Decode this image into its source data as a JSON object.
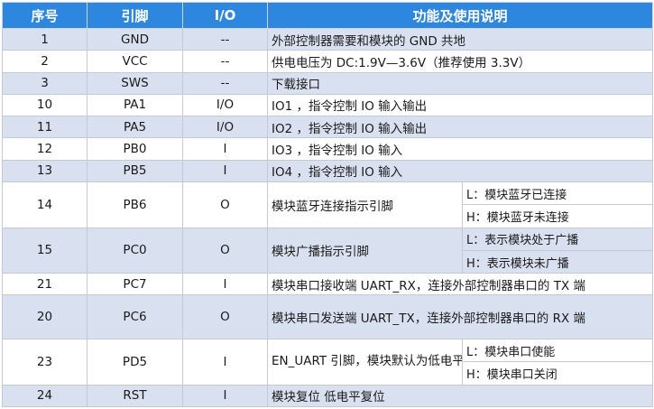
{
  "headers": {
    "index": "序号",
    "pin": "引脚",
    "io": "I/O",
    "function": "功能及使用说明"
  },
  "rows": [
    {
      "index": "1",
      "pin": "GND",
      "io": "--",
      "desc": "外部控制器需要和模块的 GND 共地"
    },
    {
      "index": "2",
      "pin": "VCC",
      "io": "--",
      "desc": "供电电压为 DC:1.9V—3.6V（推荐使用 3.3V）"
    },
    {
      "index": "3",
      "pin": "SWS",
      "io": "--",
      "desc": "下载接口"
    },
    {
      "index": "10",
      "pin": "PA1",
      "io": "I/O",
      "desc": "IO1 ，指令控制  IO 输入输出"
    },
    {
      "index": "11",
      "pin": "PA5",
      "io": "I/O",
      "desc": "IO2 ，指令控制  IO 输入输出"
    },
    {
      "index": "12",
      "pin": "PB0",
      "io": "I",
      "desc": "IO3 ，指令控制  IO 输入"
    },
    {
      "index": "13",
      "pin": "PB5",
      "io": "I",
      "desc": "IO4 ，指令控制  IO 输入"
    },
    {
      "index": "14",
      "pin": "PB6",
      "io": "O",
      "desc": "模块蓝牙连接指示引脚",
      "notes": [
        "L：模块蓝牙已连接",
        "H：模块蓝牙未连接"
      ]
    },
    {
      "index": "15",
      "pin": "PC0",
      "io": "O",
      "desc": "模块广播指示引脚",
      "notes": [
        "L：表示模块处于广播",
        "H：表示模块未广播"
      ]
    },
    {
      "index": "21",
      "pin": "PC7",
      "io": "I",
      "desc": "模块串口接收端  UART_RX，连接外部控制器串口的 TX 端"
    },
    {
      "index": "20",
      "pin": "PC6",
      "io": "O",
      "desc": "模块串口发送端  UART_TX，连接外部控制器串口的 RX 端"
    },
    {
      "index": "23",
      "pin": "PD5",
      "io": "I",
      "desc": "EN_UART  引脚，模块默认为低电平。",
      "notes": [
        "L：模块串口使能",
        "H：模块串口关闭"
      ]
    },
    {
      "index": "24",
      "pin": "RST",
      "io": "I",
      "desc": "模块复位 低电平复位"
    }
  ],
  "colors": {
    "header_bg": "#2e87de",
    "shade_row": "#d9e1f0",
    "header_text": "#ffffff"
  }
}
